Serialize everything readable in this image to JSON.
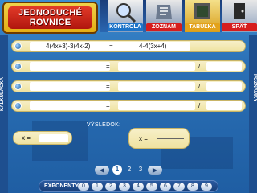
{
  "title": {
    "line1": "JEDNODUCHÉ",
    "line2": "ROVNICE"
  },
  "tabs": [
    {
      "label": "KONTROLA",
      "icon": "magnifier-icon",
      "color": "#1d74c9"
    },
    {
      "label": "ZOZNAM",
      "icon": "list-icon",
      "color": "#d61d1d"
    },
    {
      "label": "TABUĽKA",
      "icon": "board-icon",
      "color": "#e3a21a"
    },
    {
      "label": "SPÄŤ",
      "icon": "door-icon",
      "color": "#d61d1d"
    }
  ],
  "side": {
    "left": "KALKULAČKA",
    "right": "POZNÁMKY"
  },
  "equation": {
    "left": "4(4x+3)-3(4x-2)",
    "eq": "=",
    "right": "4-4(3x+4)"
  },
  "steps": [
    {
      "eq": "=",
      "slash": "/"
    },
    {
      "eq": "=",
      "slash": "/"
    },
    {
      "eq": "=",
      "slash": "/"
    }
  ],
  "result": {
    "label": "VÝSLEDOK:",
    "var1": "x =",
    "var2": "x ="
  },
  "pager": {
    "prev": "◀",
    "next": "▶",
    "pages": [
      "1",
      "2",
      "3"
    ],
    "active": "1"
  },
  "exponents": {
    "label": "EXPONENTY",
    "keys": [
      "0",
      "1",
      "2",
      "3",
      "4",
      "5",
      "6",
      "7",
      "8",
      "9"
    ]
  }
}
